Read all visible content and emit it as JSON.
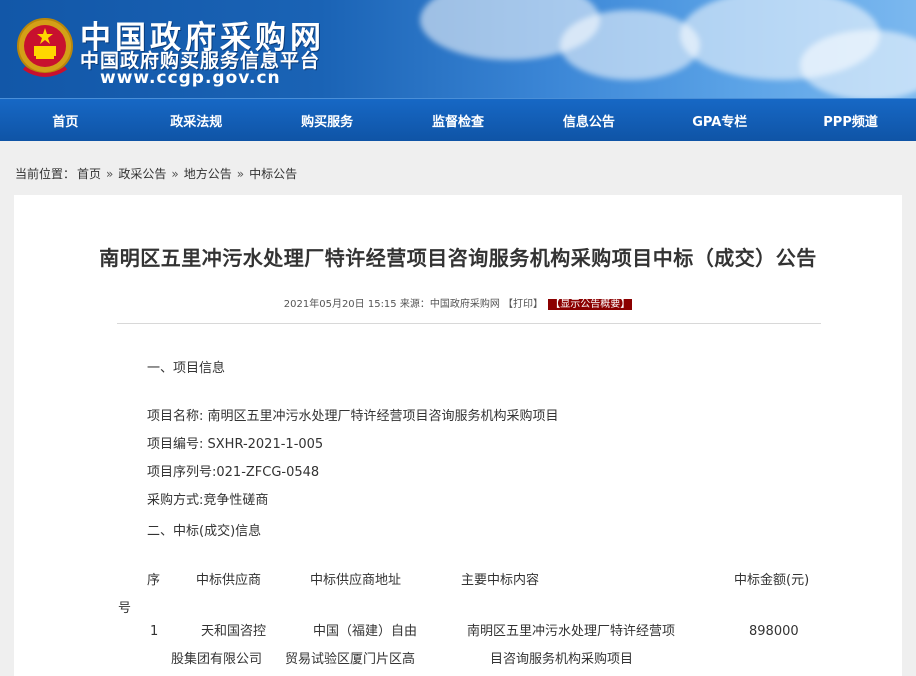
{
  "header": {
    "site_name": "中国政府采购网",
    "platform_name": "中国政府购买服务信息平台",
    "url": "www.ccgp.gov.cn"
  },
  "nav": {
    "items": [
      "首页",
      "政采法规",
      "购买服务",
      "监督检查",
      "信息公告",
      "GPA专栏",
      "PPP频道"
    ]
  },
  "breadcrumb": {
    "prefix": "当前位置：",
    "items": [
      "首页",
      "政采公告",
      "地方公告",
      "中标公告"
    ],
    "separator": "»"
  },
  "article": {
    "title": "南明区五里冲污水处理厂特许经营项目咨询服务机构采购项目中标（成交）公告",
    "meta_date": "2021年05月20日 15:15",
    "meta_source": "来源：中国政府采购网",
    "print_label": "【打印】",
    "summary_label": "【显示公告概要】",
    "section1": "一、项目信息",
    "project_name": "项目名称: 南明区五里冲污水处理厂特许经营项目咨询服务机构采购项目",
    "project_code": "项目编号: SXHR-2021-1-005",
    "project_serial": "项目序列号:021-ZFCG-0548",
    "procurement_method": "采购方式:竞争性磋商",
    "section2": "二、中标(成交)信息"
  },
  "table": {
    "headers": {
      "seq_1": "序",
      "seq_2": "号",
      "supplier": "中标供应商",
      "address": "中标供应商地址",
      "content": "主要中标内容",
      "amount": "中标金额(元)"
    },
    "rows": [
      {
        "seq": "1",
        "supplier_1": "天和国咨控",
        "supplier_2": "股集团有限公司",
        "address_1": "中国（福建）自由",
        "address_2": "贸易试验区厦门片区高",
        "content_1": "南明区五里冲污水处理厂特许经营项",
        "content_2": "目咨询服务机构采购项目",
        "amount": "898000"
      }
    ]
  },
  "colors": {
    "nav_bg": "#1560b8",
    "summary_tag": "#8b0000"
  }
}
